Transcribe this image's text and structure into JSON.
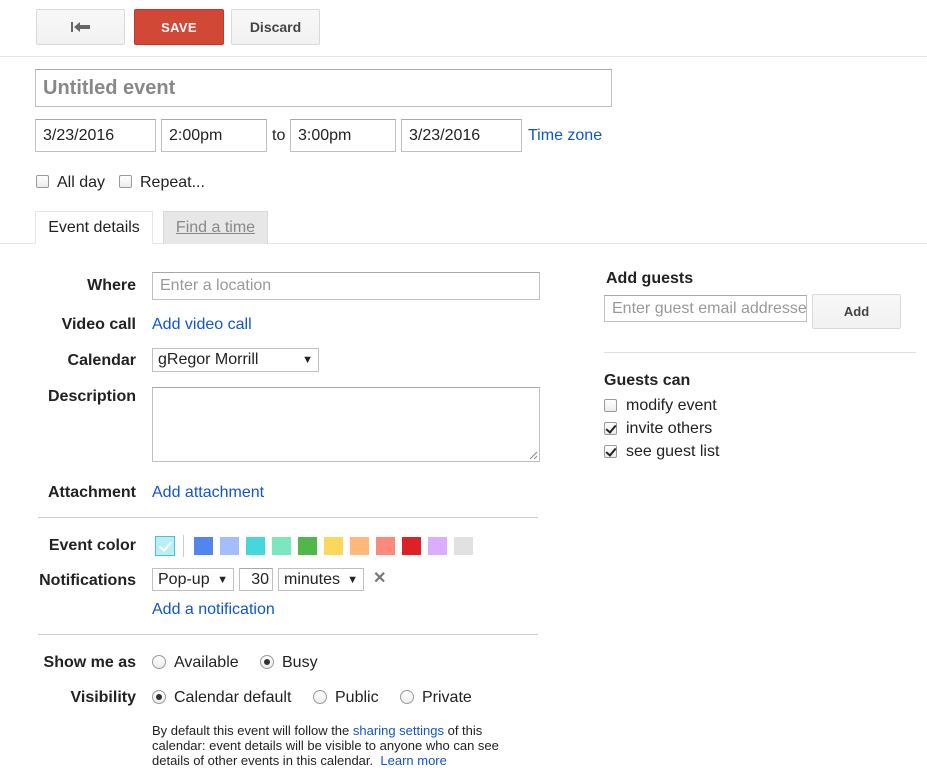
{
  "toolbar": {
    "back_icon": "back-arrow-icon",
    "save_label": "SAVE",
    "discard_label": "Discard"
  },
  "event": {
    "title_placeholder": "Untitled event",
    "start_date": "3/23/2016",
    "start_time": "2:00pm",
    "to_label": "to",
    "end_time": "3:00pm",
    "end_date": "3/23/2016",
    "timezone_link": "Time zone",
    "all_day_label": "All day",
    "repeat_label": "Repeat..."
  },
  "tabs": [
    {
      "label": "Event details",
      "active": true
    },
    {
      "label": "Find a time",
      "active": false
    }
  ],
  "details": {
    "where_label": "Where",
    "where_placeholder": "Enter a location",
    "video_label": "Video call",
    "video_link": "Add video call",
    "calendar_label": "Calendar",
    "calendar_value": "gRegor Morrill",
    "description_label": "Description",
    "attachment_label": "Attachment",
    "attachment_link": "Add attachment",
    "color_label": "Event color",
    "colors": [
      "#5484ed",
      "#a4bdfc",
      "#46d6db",
      "#7ae7bf",
      "#51b749",
      "#fbd75b",
      "#ffb878",
      "#ff887c",
      "#dc2127",
      "#dbadff",
      "#e1e1e1"
    ],
    "notifications_label": "Notifications",
    "notif_method": "Pop-up",
    "notif_amount": "30",
    "notif_unit": "minutes",
    "add_notification_link": "Add a notification",
    "show_as_label": "Show me as",
    "show_as_options": [
      "Available",
      "Busy"
    ],
    "show_as_selected": "Busy",
    "visibility_label": "Visibility",
    "visibility_options": [
      "Calendar default",
      "Public",
      "Private"
    ],
    "visibility_selected": "Calendar default",
    "visibility_note_1": "By default this event will follow the",
    "visibility_note_link": "sharing settings",
    "visibility_note_2": "of this",
    "visibility_note_3": "calendar: event details will be visible to anyone who can see",
    "visibility_note_4": "details of other events in this calendar.",
    "learn_more_link": "Learn more"
  },
  "guests": {
    "add_label": "Add guests",
    "email_placeholder": "Enter guest email addresses",
    "add_button": "Add",
    "guests_can_label": "Guests can",
    "permissions": [
      {
        "label": "modify event",
        "checked": false
      },
      {
        "label": "invite others",
        "checked": true
      },
      {
        "label": "see guest list",
        "checked": true
      }
    ]
  }
}
